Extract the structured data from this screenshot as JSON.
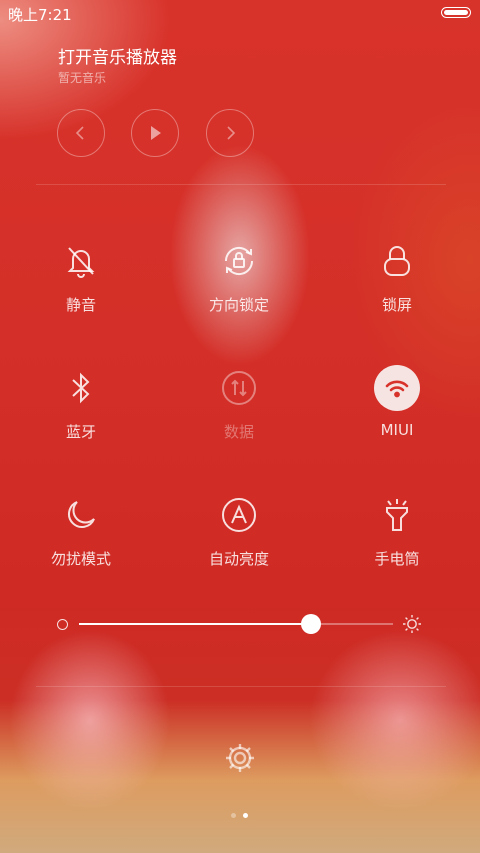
{
  "status": {
    "time": "晚上7:21"
  },
  "music": {
    "title": "打开音乐播放器",
    "subtitle": "暂无音乐"
  },
  "toggles": [
    {
      "label": "静音",
      "icon": "bell-off-icon",
      "state": "on"
    },
    {
      "label": "方向锁定",
      "icon": "rotation-lock-icon",
      "state": "on"
    },
    {
      "label": "锁屏",
      "icon": "lock-icon",
      "state": "on"
    },
    {
      "label": "蓝牙",
      "icon": "bluetooth-icon",
      "state": "on"
    },
    {
      "label": "数据",
      "icon": "data-icon",
      "state": "off"
    },
    {
      "label": "MIUI",
      "icon": "wifi-icon",
      "state": "active"
    },
    {
      "label": "勿扰模式",
      "icon": "moon-icon",
      "state": "on"
    },
    {
      "label": "自动亮度",
      "icon": "auto-brightness-icon",
      "state": "on"
    },
    {
      "label": "手电筒",
      "icon": "flashlight-icon",
      "state": "on"
    }
  ],
  "brightness": {
    "level": 0.74
  },
  "pager": {
    "pages": 2,
    "current": 2
  },
  "colors": {
    "accent": "#d8332b",
    "active_toggle_bg": "#f6e4e2"
  }
}
